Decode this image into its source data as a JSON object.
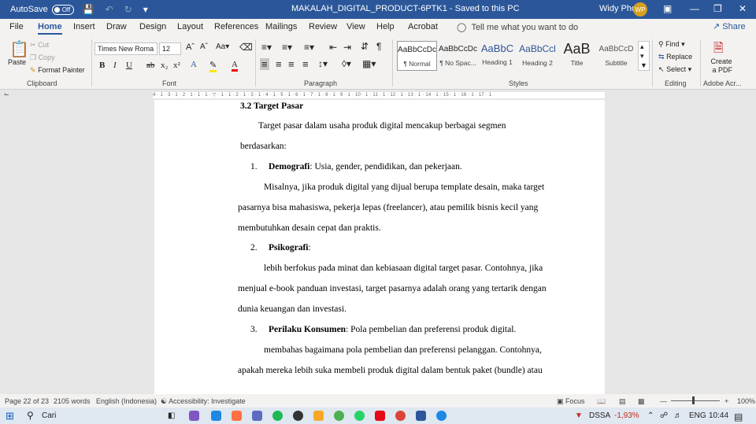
{
  "titlebar": {
    "autosave_label": "AutoSave",
    "autosave_state": "Off",
    "doc_title": "MAKALAH_DIGITAL_PRODUCT-6PTK1  -  Saved to this PC",
    "user_name": "Widy Pho",
    "user_initials": "WP"
  },
  "tabs": [
    "File",
    "Home",
    "Insert",
    "Draw",
    "Design",
    "Layout",
    "References",
    "Mailings",
    "Review",
    "View",
    "Help",
    "Acrobat"
  ],
  "tell_me": "Tell me what you want to do",
  "share_label": "Share",
  "clipboard": {
    "paste": "Paste",
    "cut": "Cut",
    "copy": "Copy",
    "format_painter": "Format Painter",
    "group": "Clipboard"
  },
  "font": {
    "name": "Times New Roma",
    "size": "12",
    "group": "Font"
  },
  "paragraph": {
    "group": "Paragraph"
  },
  "styles": {
    "group": "Styles",
    "items": [
      {
        "preview": "AaBbCcDc",
        "name": "¶ Normal"
      },
      {
        "preview": "AaBbCcDc",
        "name": "¶ No Spac..."
      },
      {
        "preview": "AaBbC",
        "name": "Heading 1"
      },
      {
        "preview": "AaBbCcl",
        "name": "Heading 2"
      },
      {
        "preview": "AaB",
        "name": "Title"
      },
      {
        "preview": "AaBbCcD",
        "name": "Subtitle"
      }
    ]
  },
  "editing": {
    "find": "Find",
    "replace": "Replace",
    "select": "Select",
    "group": "Editing"
  },
  "adobe": {
    "create": "Create",
    "pdf": "a PDF",
    "group": "Adobe Acr..."
  },
  "ruler": "4 · 1 · 3 · 1 · 2 · 1 · 1 · 1 · ▽ · 1 · 1 · 2 · 1 · 3 · 1 · 4 · 1 · 5 · 1 · 6 · 1 · 7 · 1 · 8 · 1 · 9 · 1 · 10 · 1 · 11 · 1 · 12 · 1 · 13 · 1 · 14 · 1 · 15 · 1 · 16 · 1 · 17 · 1",
  "document": {
    "heading": "3.2    Target Pasar",
    "intro_1": "Target pasar dalam usaha produk digital mencakup berbagai segmen",
    "intro_2": "berdasarkan:",
    "item1_num": "1.",
    "item1_bold": "Demografi",
    "item1_rest": ": Usia, gender, pendidikan, dan pekerjaan.",
    "p1_1": "Misalnya, jika produk digital yang dijual berupa template desain, maka target",
    "p1_2": "pasarnya bisa mahasiswa, pekerja lepas (freelancer), atau pemilik bisnis kecil yang",
    "p1_3": "membutuhkan desain cepat dan praktis.",
    "item2_num": "2.",
    "item2_bold": "Psikografi",
    "item2_rest": ":",
    "p2_1": "lebih berfokus pada minat dan kebiasaan digital target pasar. Contohnya, jika",
    "p2_2": "menjual e-book panduan investasi, target pasarnya adalah orang yang tertarik dengan",
    "p2_3": "dunia keuangan dan investasi.",
    "item3_num": "3.",
    "item3_bold": "Perilaku Konsumen",
    "item3_rest": ": Pola pembelian dan preferensi produk digital.",
    "p3_1": "membahas bagaimana pola pembelian dan preferensi pelanggan. Contohnya,",
    "p3_2": "apakah mereka lebih suka membeli produk digital dalam bentuk paket (bundle) atau"
  },
  "status": {
    "page": "Page 22 of 23",
    "words": "2105 words",
    "language": "English (Indonesia)",
    "accessibility": "Accessibility: Investigate",
    "focus": "Focus",
    "zoom": "100%"
  },
  "taskbar": {
    "search": "Cari",
    "stock": "DSSA",
    "stock_change": "-1,93%",
    "lang": "ENG",
    "time": "10:44"
  },
  "colors": {
    "word_blue": "#2b579a",
    "stock_red": "#c42b1c"
  }
}
